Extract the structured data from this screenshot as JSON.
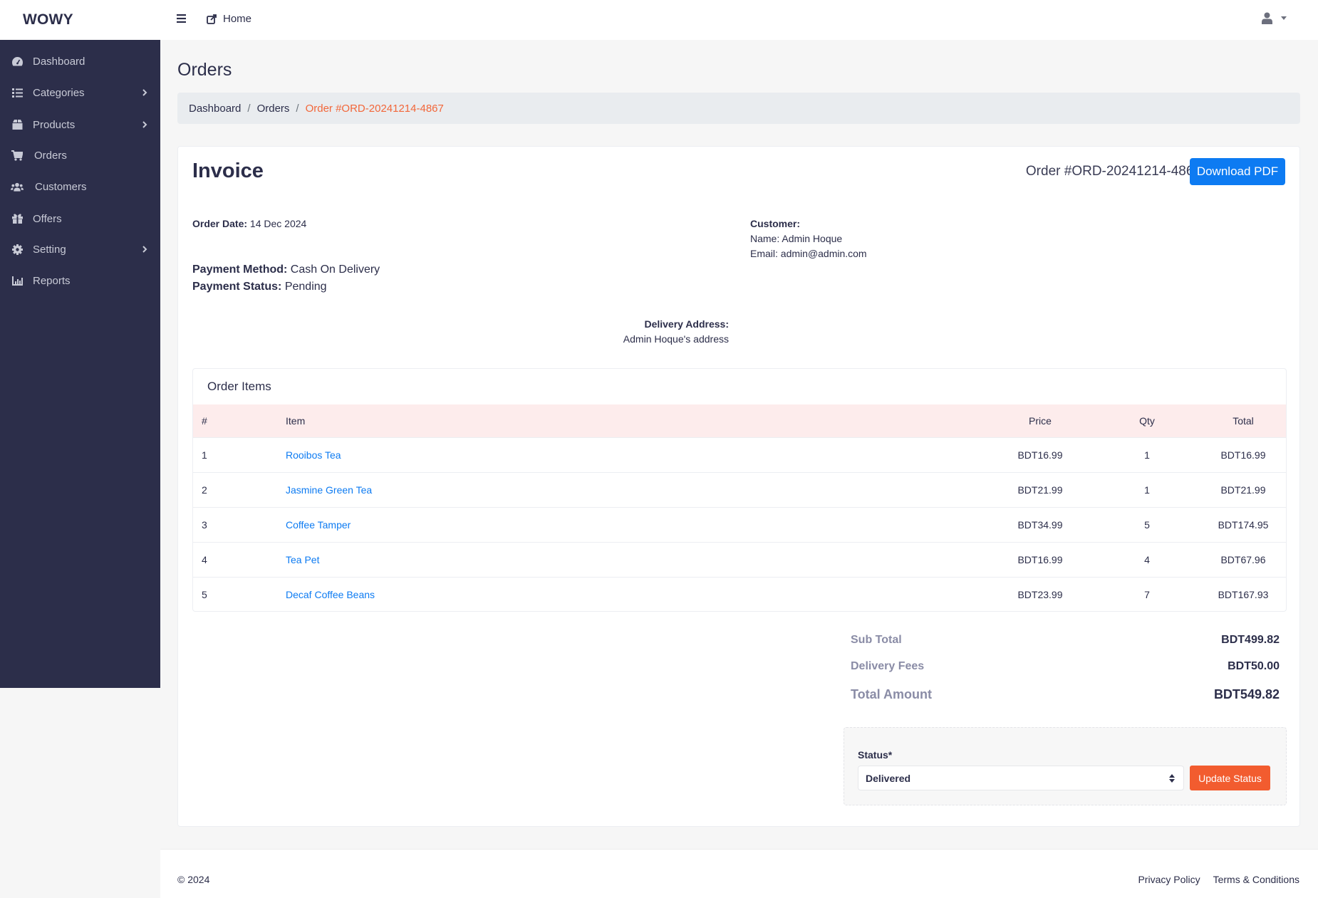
{
  "brand": "WOWY",
  "topbar": {
    "home_label": "Home"
  },
  "sidebar": {
    "items": [
      {
        "label": "Dashboard",
        "icon": "dashboard-icon",
        "has_submenu": false
      },
      {
        "label": "Categories",
        "icon": "list-icon",
        "has_submenu": true
      },
      {
        "label": "Products",
        "icon": "box-icon",
        "has_submenu": true
      },
      {
        "label": "Orders",
        "icon": "cart-icon",
        "has_submenu": false
      },
      {
        "label": "Customers",
        "icon": "users-icon",
        "has_submenu": false
      },
      {
        "label": "Offers",
        "icon": "gift-icon",
        "has_submenu": false
      },
      {
        "label": "Setting",
        "icon": "gear-icon",
        "has_submenu": true
      },
      {
        "label": "Reports",
        "icon": "chart-bar-icon",
        "has_submenu": false
      }
    ]
  },
  "page": {
    "title": "Orders",
    "breadcrumb": [
      "Dashboard",
      "Orders",
      "Order #ORD-20241214-4867"
    ],
    "breadcrumb_sep": "/"
  },
  "invoice": {
    "title": "Invoice",
    "order_number": "Order #ORD-20241214-4867",
    "download_label": "Download PDF",
    "order_date_label": "Order Date:",
    "order_date": "14 Dec 2024",
    "payment_method_label": "Payment Method:",
    "payment_method": "Cash On Delivery",
    "payment_status_label": "Payment Status:",
    "payment_status": "Pending",
    "customer_label": "Customer:",
    "customer_name": "Name: Admin Hoque",
    "customer_email": "Email: admin@admin.com",
    "delivery_label": "Delivery Address:",
    "delivery_address": "Admin Hoque's address"
  },
  "order_items": {
    "title": "Order Items",
    "columns": [
      "#",
      "Item",
      "Price",
      "Qty",
      "Total"
    ],
    "rows": [
      {
        "num": "1",
        "item": "Rooibos Tea",
        "price": "BDT16.99",
        "qty": "1",
        "total": "BDT16.99"
      },
      {
        "num": "2",
        "item": "Jasmine Green Tea",
        "price": "BDT21.99",
        "qty": "1",
        "total": "BDT21.99"
      },
      {
        "num": "3",
        "item": "Coffee Tamper",
        "price": "BDT34.99",
        "qty": "5",
        "total": "BDT174.95"
      },
      {
        "num": "4",
        "item": "Tea Pet",
        "price": "BDT16.99",
        "qty": "4",
        "total": "BDT67.96"
      },
      {
        "num": "5",
        "item": "Decaf Coffee Beans",
        "price": "BDT23.99",
        "qty": "7",
        "total": "BDT167.93"
      }
    ]
  },
  "summary": {
    "subtotal_label": "Sub Total",
    "subtotal": "BDT499.82",
    "delivery_label": "Delivery Fees",
    "delivery": "BDT50.00",
    "total_label": "Total Amount",
    "total": "BDT549.82"
  },
  "status_form": {
    "label": "Status*",
    "selected": "Delivered",
    "button": "Update Status"
  },
  "footer": {
    "copyright": "© 2024",
    "links": [
      "Privacy Policy",
      "Terms & Conditions"
    ]
  },
  "colors": {
    "sidebar_bg": "#2c2e4a",
    "accent_orange": "#f25c2f",
    "primary_blue": "#0d7bf2",
    "table_head_bg": "#fdecec"
  }
}
